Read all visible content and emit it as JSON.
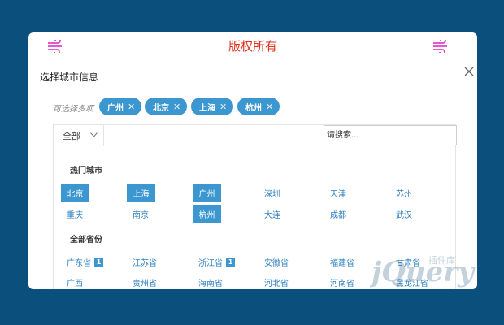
{
  "header": {
    "brand": "版权所有"
  },
  "dialog": {
    "title": "选择城市信息",
    "multi_label": "可选择多项",
    "close_icon": "close-icon"
  },
  "chips": [
    {
      "label": "广州"
    },
    {
      "label": "北京"
    },
    {
      "label": "上海"
    },
    {
      "label": "杭州"
    }
  ],
  "tabs": {
    "all_label": "全部"
  },
  "search": {
    "placeholder": "请搜索..."
  },
  "hot": {
    "title": "热门城市",
    "cities": [
      {
        "name": "北京",
        "selected": true
      },
      {
        "name": "上海",
        "selected": true
      },
      {
        "name": "广州",
        "selected": true
      },
      {
        "name": "深圳",
        "selected": false
      },
      {
        "name": "天津",
        "selected": false
      },
      {
        "name": "苏州",
        "selected": false
      },
      {
        "name": "重庆",
        "selected": false
      },
      {
        "name": "南京",
        "selected": false
      },
      {
        "name": "杭州",
        "selected": true
      },
      {
        "name": "大连",
        "selected": false
      },
      {
        "name": "成都",
        "selected": false
      },
      {
        "name": "武汉",
        "selected": false
      }
    ]
  },
  "provinces": {
    "title": "全部省份",
    "items": [
      {
        "name": "广东省",
        "count": "1"
      },
      {
        "name": "江苏省",
        "count": ""
      },
      {
        "name": "浙江省",
        "count": "1"
      },
      {
        "name": "安徽省",
        "count": ""
      },
      {
        "name": "福建省",
        "count": ""
      },
      {
        "name": "甘肃省",
        "count": ""
      },
      {
        "name": "广西",
        "count": ""
      },
      {
        "name": "贵州省",
        "count": ""
      },
      {
        "name": "海南省",
        "count": ""
      },
      {
        "name": "河北省",
        "count": ""
      },
      {
        "name": "河南省",
        "count": ""
      },
      {
        "name": "黑龙江省",
        "count": ""
      }
    ]
  },
  "watermark": {
    "text": "插件库"
  },
  "colors": {
    "background": "#0b4f7c",
    "accent": "#3c96cf",
    "brand": "#e0301e",
    "wind_icon": "#e040c8"
  }
}
